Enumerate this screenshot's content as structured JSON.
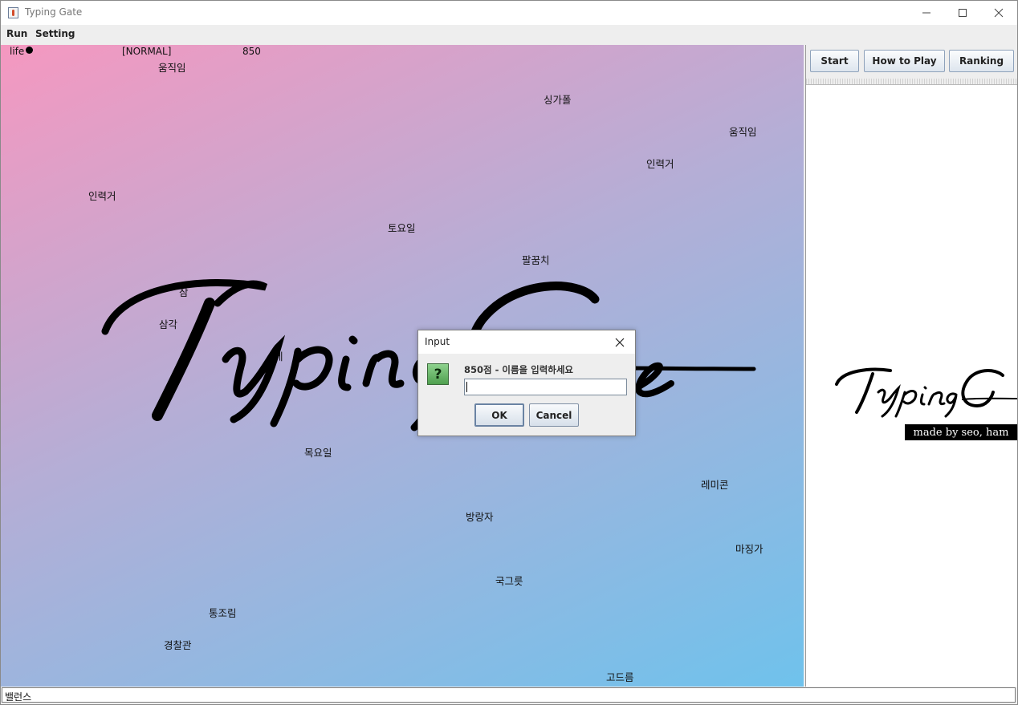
{
  "window": {
    "title": "Typing Gate"
  },
  "menu": [
    "Run",
    "Setting"
  ],
  "hud": {
    "life_label": "life",
    "mode": "[NORMAL]",
    "score": "850"
  },
  "words": [
    "움직임",
    "싱가폴",
    "움직임",
    "인력거",
    "인력거",
    "토요일",
    "팔꿈치",
    "삼",
    "삼각",
    "베",
    "크",
    "목요일",
    "레미콘",
    "방랑자",
    "마징가",
    "국그릇",
    "통조림",
    "경찰관",
    "고드름"
  ],
  "side": {
    "start": "Start",
    "how_to_play": "How to Play",
    "ranking": "Ranking",
    "credit": "made by seo, ham"
  },
  "input_field": {
    "value": "밸런스"
  },
  "dialog": {
    "title": "Input",
    "message": "850점 - 이름을 입력하세요",
    "value": "",
    "ok": "OK",
    "cancel": "Cancel"
  },
  "colors": {
    "gradient_start": "#f598c0",
    "gradient_end": "#6fc2ec"
  }
}
